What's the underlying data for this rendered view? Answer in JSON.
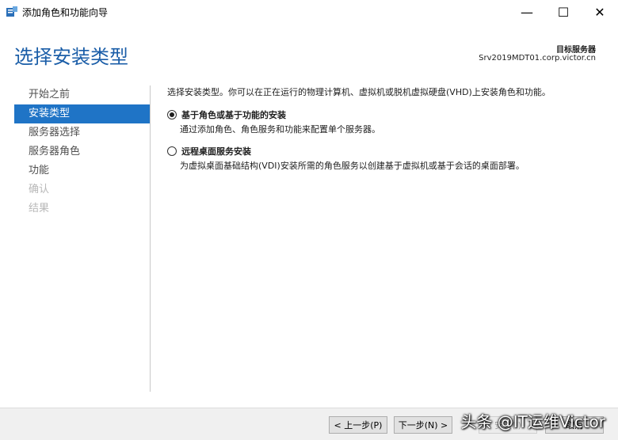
{
  "window": {
    "title": "添加角色和功能向导",
    "icon": "server-manager-icon",
    "controls": {
      "minimize": "—",
      "maximize": "☐",
      "close": "✕"
    }
  },
  "header": {
    "title": "选择安装类型",
    "target_label": "目标服务器",
    "target_name": "Srv2019MDT01.corp.victor.cn"
  },
  "nav": {
    "items": [
      {
        "label": "开始之前",
        "state": "normal"
      },
      {
        "label": "安装类型",
        "state": "active"
      },
      {
        "label": "服务器选择",
        "state": "normal"
      },
      {
        "label": "服务器角色",
        "state": "normal"
      },
      {
        "label": "功能",
        "state": "normal"
      },
      {
        "label": "确认",
        "state": "disabled"
      },
      {
        "label": "结果",
        "state": "disabled"
      }
    ]
  },
  "main": {
    "intro": "选择安装类型。你可以在正在运行的物理计算机、虚拟机或脱机虚拟硬盘(VHD)上安装角色和功能。",
    "options": [
      {
        "label": "基于角色或基于功能的安装",
        "description": "通过添加角色、角色服务和功能来配置单个服务器。",
        "selected": true
      },
      {
        "label": "远程桌面服务安装",
        "description": "为虚拟桌面基础结构(VDI)安装所需的角色服务以创建基于虚拟机或基于会话的桌面部署。",
        "selected": false
      }
    ]
  },
  "footer": {
    "prev": "< 上一步(P)",
    "next": "下一步(N) >",
    "install": "安装(I)",
    "cancel": "取消"
  },
  "watermark": "头条 @IT运维Victor",
  "colors": {
    "accent": "#1f74c6",
    "title_blue": "#1b5ea8"
  }
}
